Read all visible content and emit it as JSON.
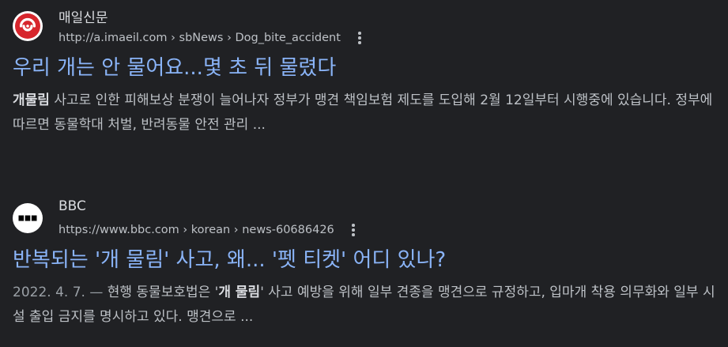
{
  "results": [
    {
      "site_name": "매일신문",
      "url": "http://a.imaeil.com › sbNews › Dog_bite_accident",
      "favicon": "imaeil-logo-icon",
      "favicon_color": "#d7262d",
      "title": "우리 개는 안 물어요...몇 초 뒤 물렸다",
      "snippet_date": "",
      "snippet_bold": "개물림",
      "snippet_before": "",
      "snippet_after": " 사고로 인한 피해보상 분쟁이 늘어나자 정부가 맹견 책임보험 제도를 도입해 2월 12일부터 시행중에 있습니다. 정부에 따르면 동물학대 처벌, 반려동물 안전 관리 ..."
    },
    {
      "site_name": "BBC",
      "url": "https://www.bbc.com › korean › news-60686426",
      "favicon": "bbc-logo-icon",
      "favicon_color": "#000000",
      "title": "반복되는 '개 물림' 사고, 왜... '펫 티켓' 어디 있나?",
      "snippet_date": "2022. 4. 7. — ",
      "snippet_before": "현행 동물보호법은 '",
      "snippet_bold": "개 물림",
      "snippet_after": "' 사고 예방을 위해 일부 견종을 맹견으로 규정하고, 입마개 착용 의무화와 일부 시설 출입 금지를 명시하고 있다. 맹견으로 ..."
    }
  ],
  "colors": {
    "background": "#202124",
    "title_link": "#8ab4f8",
    "snippet_text": "#bdc1c6",
    "site_name": "#dadce0"
  }
}
